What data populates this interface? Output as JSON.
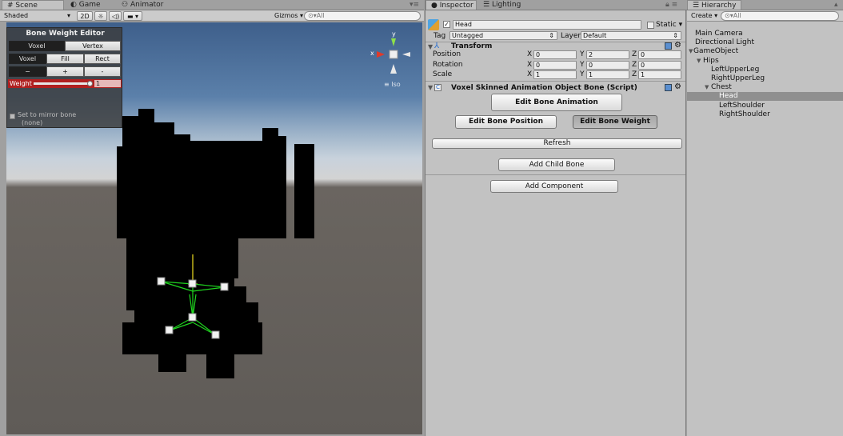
{
  "scene_panel": {
    "tabs": [
      "Scene",
      "Game",
      "Animator"
    ],
    "tab_icons": [
      "scene-grid-icon",
      "game-pacman-icon",
      "animator-icon"
    ],
    "shading_mode": "Shaded",
    "toggle_2d": "2D",
    "gizmos_label": "Gizmos",
    "search_placeholder": "All",
    "projection_label": "Iso",
    "gizmo_axis_y": "y",
    "gizmo_axis_x": "x"
  },
  "bone_weight_editor": {
    "title": "Bone Weight Editor",
    "mode_buttons": [
      "Voxel",
      "Vertex"
    ],
    "tool_buttons": [
      "Voxel",
      "Fill",
      "Rect"
    ],
    "op_buttons": [
      "−",
      "+",
      "-"
    ],
    "weight_label": "Weight",
    "weight_value": "1",
    "weight_fraction": 1.0,
    "mirror_label": "Set to mirror bone",
    "mirror_value": "(none)"
  },
  "inspector": {
    "tabs": [
      "Inspector",
      "Lighting"
    ],
    "object_name": "Head",
    "active_checked": true,
    "static_label": "Static",
    "tag_label": "Tag",
    "tag_value": "Untagged",
    "layer_label": "Layer",
    "layer_value": "Default",
    "transform": {
      "title": "Transform",
      "rows": [
        {
          "label": "Position",
          "x": "0",
          "y": "2",
          "z": "0"
        },
        {
          "label": "Rotation",
          "x": "0",
          "y": "0",
          "z": "0"
        },
        {
          "label": "Scale",
          "x": "1",
          "y": "1",
          "z": "1"
        }
      ],
      "axes": [
        "X",
        "Y",
        "Z"
      ]
    },
    "script": {
      "title": "Voxel Skinned Animation Object Bone (Script)",
      "edit_animation": "Edit Bone Animation",
      "edit_position": "Edit Bone Position",
      "edit_weight": "Edit Bone Weight",
      "refresh": "Refresh",
      "add_child": "Add Child Bone"
    },
    "add_component": "Add Component"
  },
  "hierarchy": {
    "tab": "Hierarchy",
    "create_label": "Create",
    "search_placeholder": "All",
    "items": [
      {
        "label": "Main Camera",
        "depth": 0,
        "arrow": ""
      },
      {
        "label": "Directional Light",
        "depth": 0,
        "arrow": ""
      },
      {
        "label": "GameObject",
        "depth": 0,
        "arrow": "▼"
      },
      {
        "label": "Hips",
        "depth": 1,
        "arrow": "▼"
      },
      {
        "label": "LeftUpperLeg",
        "depth": 2,
        "arrow": ""
      },
      {
        "label": "RightUpperLeg",
        "depth": 2,
        "arrow": ""
      },
      {
        "label": "Chest",
        "depth": 2,
        "arrow": "▼"
      },
      {
        "label": "Head",
        "depth": 3,
        "arrow": "",
        "selected": true
      },
      {
        "label": "LeftShoulder",
        "depth": 3,
        "arrow": ""
      },
      {
        "label": "RightShoulder",
        "depth": 3,
        "arrow": ""
      }
    ]
  },
  "colors": {
    "sky_top": "#3d5f8a",
    "horizon": "#c9d3dd",
    "ground": "#5e5a56",
    "selection": "#8f8f8f",
    "bone_green": "#1fd41f",
    "bone_yellow": "#f0e020",
    "weight_red": "#c02020"
  }
}
